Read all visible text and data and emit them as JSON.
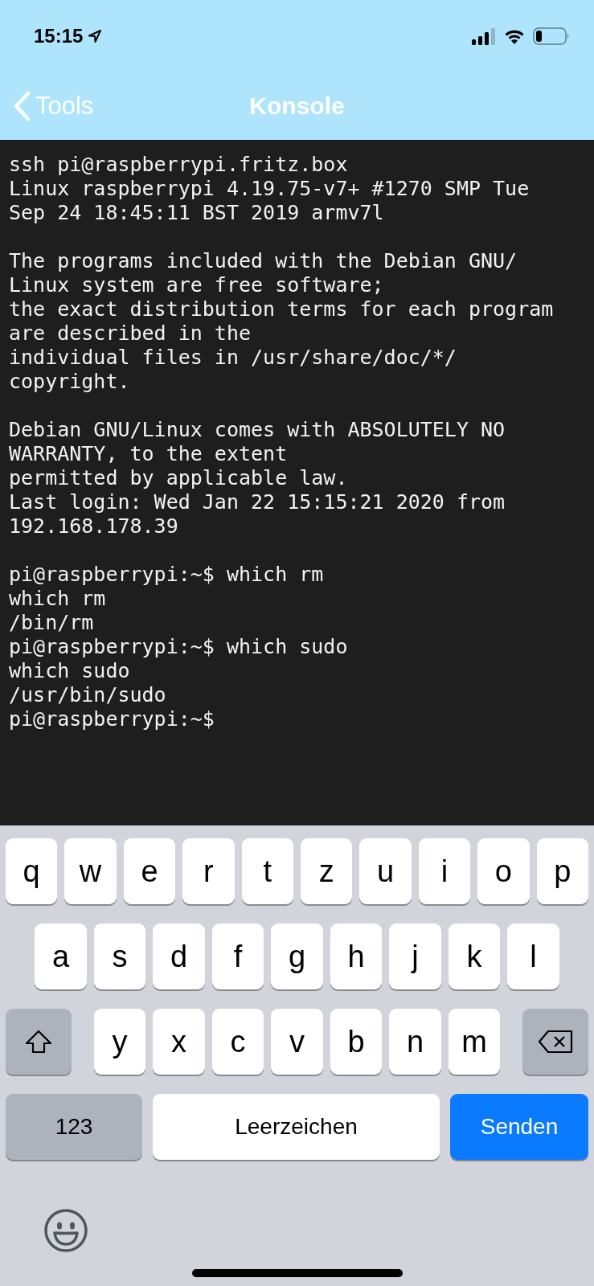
{
  "status_bar": {
    "time": "15:15"
  },
  "nav": {
    "back_label": "Tools",
    "title": "Konsole"
  },
  "terminal": {
    "blocks": [
      {
        "lines": [
          "ssh pi@raspberrypi.fritz.box",
          "Linux raspberrypi 4.19.75-v7+ #1270 SMP Tue",
          "Sep 24 18:45:11 BST 2019 armv7l"
        ]
      },
      {
        "lines": [
          "The programs included with the Debian GNU/",
          "Linux system are free software;",
          "the exact distribution terms for each program",
          "are described in the",
          "individual files in /usr/share/doc/*/",
          "copyright."
        ]
      },
      {
        "lines": [
          "Debian GNU/Linux comes with ABSOLUTELY NO",
          "WARRANTY, to the extent",
          "permitted by applicable law.",
          "Last login: Wed Jan 22 15:15:21 2020 from",
          "192.168.178.39"
        ]
      },
      {
        "lines": [
          "pi@raspberrypi:~$ which rm",
          "which rm",
          "/bin/rm",
          "pi@raspberrypi:~$ which sudo",
          "which sudo",
          "/usr/bin/sudo",
          "pi@raspberrypi:~$"
        ]
      }
    ]
  },
  "keyboard": {
    "rows": [
      {
        "keys": [
          {
            "kind": "letter",
            "label": "q"
          },
          {
            "kind": "letter",
            "label": "w"
          },
          {
            "kind": "letter",
            "label": "e"
          },
          {
            "kind": "letter",
            "label": "r"
          },
          {
            "kind": "letter",
            "label": "t"
          },
          {
            "kind": "letter",
            "label": "z"
          },
          {
            "kind": "letter",
            "label": "u"
          },
          {
            "kind": "letter",
            "label": "i"
          },
          {
            "kind": "letter",
            "label": "o"
          },
          {
            "kind": "letter",
            "label": "p"
          }
        ]
      },
      {
        "keys": [
          {
            "kind": "letter",
            "label": "a"
          },
          {
            "kind": "letter",
            "label": "s"
          },
          {
            "kind": "letter",
            "label": "d"
          },
          {
            "kind": "letter",
            "label": "f"
          },
          {
            "kind": "letter",
            "label": "g"
          },
          {
            "kind": "letter",
            "label": "h"
          },
          {
            "kind": "letter",
            "label": "j"
          },
          {
            "kind": "letter",
            "label": "k"
          },
          {
            "kind": "letter",
            "label": "l"
          }
        ]
      },
      {
        "keys": [
          {
            "kind": "shift"
          },
          {
            "kind": "letter",
            "label": "y"
          },
          {
            "kind": "letter",
            "label": "x"
          },
          {
            "kind": "letter",
            "label": "c"
          },
          {
            "kind": "letter",
            "label": "v"
          },
          {
            "kind": "letter",
            "label": "b"
          },
          {
            "kind": "letter",
            "label": "n"
          },
          {
            "kind": "letter",
            "label": "m"
          },
          {
            "kind": "backspace"
          }
        ]
      },
      {
        "keys": [
          {
            "kind": "numbers",
            "label": "123"
          },
          {
            "kind": "space",
            "label": "Leerzeichen"
          },
          {
            "kind": "send",
            "label": "Senden"
          }
        ]
      }
    ]
  }
}
